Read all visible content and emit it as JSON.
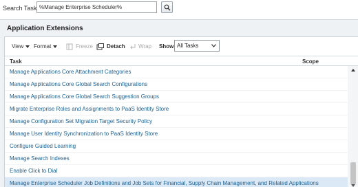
{
  "search": {
    "label": "Search Tasks",
    "value": "%Manage Enterprise Scheduler%"
  },
  "panel": {
    "title": "Application Extensions"
  },
  "toolbar": {
    "view_label": "View",
    "format_label": "Format",
    "freeze_label": "Freeze",
    "detach_label": "Detach",
    "wrap_label": "Wrap",
    "show_label": "Show",
    "show_value": "All Tasks"
  },
  "table": {
    "columns": [
      "Task",
      "Scope"
    ],
    "rows": [
      "Manage Applications Core Attachment Categories",
      "Manage Applications Core Global Search Configurations",
      "Manage Applications Core Global Search Suggestion Groups",
      "Migrate Enterprise Roles and Assignments to PaaS Identity Store",
      "Manage Configuration Set Migration Target Security Policy",
      "Manage User Identity Synchronization to PaaS Identity Store",
      "Configure Guided Learning",
      "Manage Search Indexes",
      "Enable Click to Dial",
      "Manage Enterprise Scheduler Job Definitions and Job Sets for Financial, Supply Chain Management, and Related Applications"
    ],
    "selected_index": 9
  },
  "colors": {
    "link": "#1b5f94",
    "panel_bg": "#eef2f5",
    "selected_row": "#dbe9f6"
  }
}
